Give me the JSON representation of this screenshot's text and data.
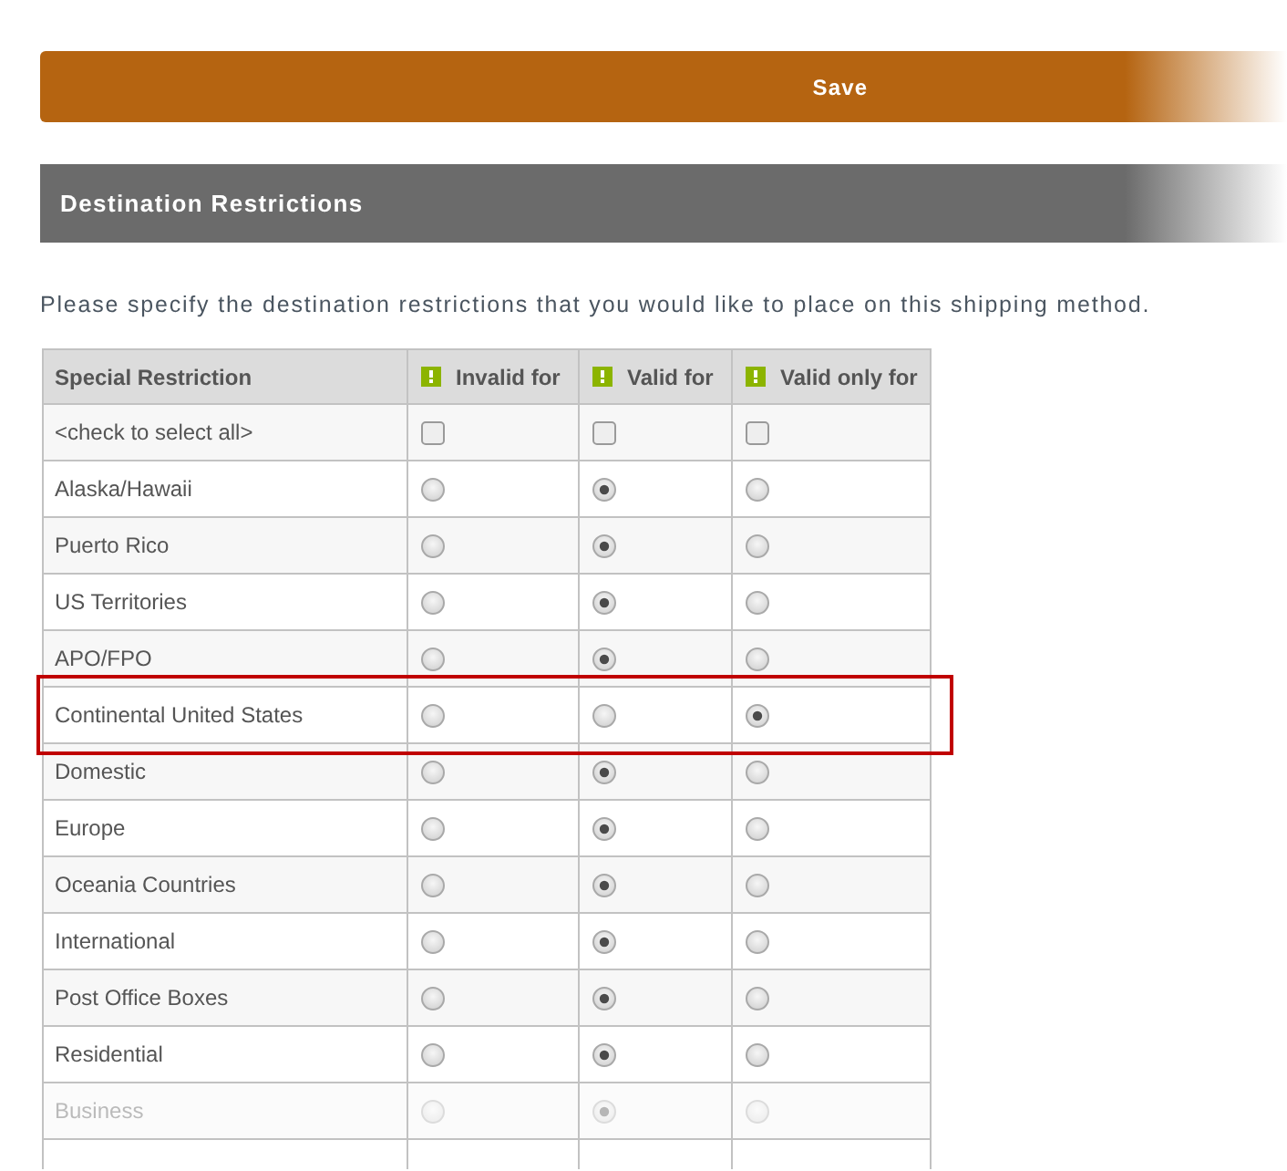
{
  "save_button": {
    "label": "Save"
  },
  "section": {
    "title": "Destination Restrictions"
  },
  "intro": "Please specify the destination restrictions that you would like to place on this shipping method.",
  "table": {
    "columns": [
      {
        "label": "Special Restriction",
        "kind": "text"
      },
      {
        "label": "Invalid for",
        "kind": "choice"
      },
      {
        "label": "Valid for",
        "kind": "choice"
      },
      {
        "label": "Valid only for",
        "kind": "choice"
      }
    ],
    "rows": [
      {
        "kind": "select_all",
        "label": "<check to select all>",
        "highlighted": false,
        "options": [
          {
            "checked": false
          },
          {
            "checked": false
          },
          {
            "checked": false
          }
        ]
      },
      {
        "kind": "radio",
        "label": "Alaska/Hawaii",
        "highlighted": false,
        "options": [
          {
            "selected": false
          },
          {
            "selected": true
          },
          {
            "selected": false
          }
        ]
      },
      {
        "kind": "radio",
        "label": "Puerto Rico",
        "highlighted": false,
        "options": [
          {
            "selected": false
          },
          {
            "selected": true
          },
          {
            "selected": false
          }
        ]
      },
      {
        "kind": "radio",
        "label": "US Territories",
        "highlighted": false,
        "options": [
          {
            "selected": false
          },
          {
            "selected": true
          },
          {
            "selected": false
          }
        ]
      },
      {
        "kind": "radio",
        "label": "APO/FPO",
        "highlighted": false,
        "options": [
          {
            "selected": false
          },
          {
            "selected": true
          },
          {
            "selected": false
          }
        ]
      },
      {
        "kind": "radio",
        "label": "Continental United States",
        "highlighted": true,
        "options": [
          {
            "selected": false
          },
          {
            "selected": false
          },
          {
            "selected": true
          }
        ]
      },
      {
        "kind": "radio",
        "label": "Domestic",
        "highlighted": false,
        "options": [
          {
            "selected": false
          },
          {
            "selected": true
          },
          {
            "selected": false
          }
        ]
      },
      {
        "kind": "radio",
        "label": "Europe",
        "highlighted": false,
        "options": [
          {
            "selected": false
          },
          {
            "selected": true
          },
          {
            "selected": false
          }
        ]
      },
      {
        "kind": "radio",
        "label": "Oceania Countries",
        "highlighted": false,
        "options": [
          {
            "selected": false
          },
          {
            "selected": true
          },
          {
            "selected": false
          }
        ]
      },
      {
        "kind": "radio",
        "label": "International",
        "highlighted": false,
        "options": [
          {
            "selected": false
          },
          {
            "selected": true
          },
          {
            "selected": false
          }
        ]
      },
      {
        "kind": "radio",
        "label": "Post Office Boxes",
        "highlighted": false,
        "options": [
          {
            "selected": false
          },
          {
            "selected": true
          },
          {
            "selected": false
          }
        ]
      },
      {
        "kind": "radio",
        "label": "Residential",
        "highlighted": false,
        "options": [
          {
            "selected": false
          },
          {
            "selected": true
          },
          {
            "selected": false
          }
        ]
      },
      {
        "kind": "radio",
        "label": "Business",
        "highlighted": false,
        "options": [
          {
            "selected": false
          },
          {
            "selected": true
          },
          {
            "selected": false
          }
        ]
      }
    ]
  }
}
